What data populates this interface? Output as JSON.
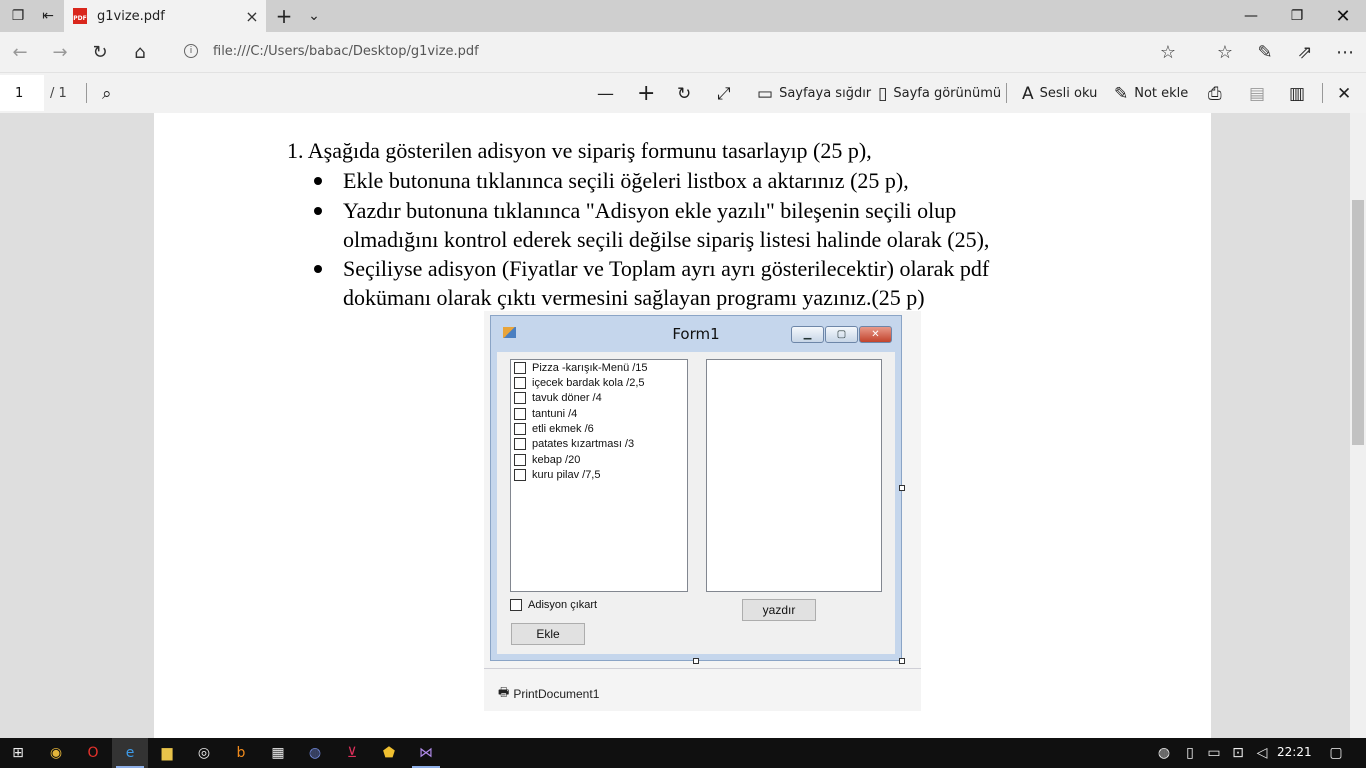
{
  "browser": {
    "tab_title": "g1vize.pdf",
    "tab_icon_label": "PDF",
    "url": "file:///C:/Users/babac/Desktop/g1vize.pdf"
  },
  "pdf_toolbar": {
    "page_current": "1",
    "page_total": "/ 1",
    "fit_page": "Sayfaya sığdır",
    "page_view": "Sayfa görünümü",
    "read_aloud": "Sesli oku",
    "add_note": "Not ekle"
  },
  "document": {
    "q1": "1.  Aşağıda gösterilen adisyon ve sipariş formunu tasarlayıp (25 p),",
    "b1": "Ekle butonuna tıklanınca seçili öğeleri listbox a aktarınız (25 p),",
    "b2_l1": "Yazdır butonuna tıklanınca \"Adisyon ekle yazılı\" bileşenin seçili olup",
    "b2_l2": "olmadığını kontrol ederek seçili değilse sipariş listesi halinde olarak (25),",
    "b3_l1": "Seçiliyse adisyon (Fiyatlar ve Toplam ayrı ayrı gösterilecektir) olarak pdf",
    "b3_l2": "dokümanı olarak çıktı vermesini sağlayan programı yazınız.(25 p)"
  },
  "form": {
    "title": "Form1",
    "items": [
      "Pizza -karışık-Menü /15",
      "içecek bardak kola /2,5",
      "tavuk döner /4",
      "tantuni /4",
      "etli ekmek /6",
      "patates kızartması /3",
      "kebap /20",
      "kuru pilav /7,5"
    ],
    "adisyon_label": "Adisyon çıkart",
    "ekle_label": "Ekle",
    "yazdir_label": "yazdır",
    "print_component": "PrintDocument1"
  },
  "taskbar": {
    "clock": "22:21"
  }
}
